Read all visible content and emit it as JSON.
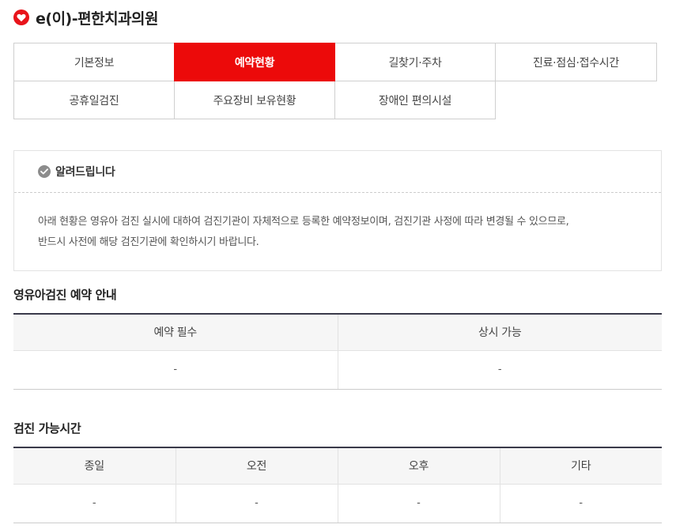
{
  "hospital": {
    "name": "e(이)-편한치과의원",
    "icon": "heart-icon",
    "brand_color": "#e8141b"
  },
  "tabs": {
    "row1": [
      {
        "label": "기본정보",
        "active": false
      },
      {
        "label": "예약현황",
        "active": true
      },
      {
        "label": "길찾기·주차",
        "active": false
      },
      {
        "label": "진료·점심·접수시간",
        "active": false
      }
    ],
    "row2": [
      {
        "label": "공휴일검진",
        "active": false
      },
      {
        "label": "주요장비 보유현황",
        "active": false
      },
      {
        "label": "장애인 편의시설",
        "active": false
      }
    ],
    "active_color": "#ec0a0a"
  },
  "notice": {
    "icon": "check-circle-icon",
    "title": "알려드립니다",
    "line1": "아래 현황은 영유아 검진 실시에 대하여 검진기관이 자체적으로 등록한 예약정보이며, 검진기관 사정에 따라 변경될 수 있으므로,",
    "line2": "반드시 사전에 해당 검진기관에 확인하시기 바랍니다."
  },
  "reservation": {
    "title": "영유아검진 예약 안내",
    "headers": [
      "예약 필수",
      "상시 가능"
    ],
    "values": [
      "-",
      "-"
    ]
  },
  "hours": {
    "title": "검진 가능시간",
    "headers": [
      "종일",
      "오전",
      "오후",
      "기타"
    ],
    "values": [
      "-",
      "-",
      "-",
      "-"
    ]
  }
}
